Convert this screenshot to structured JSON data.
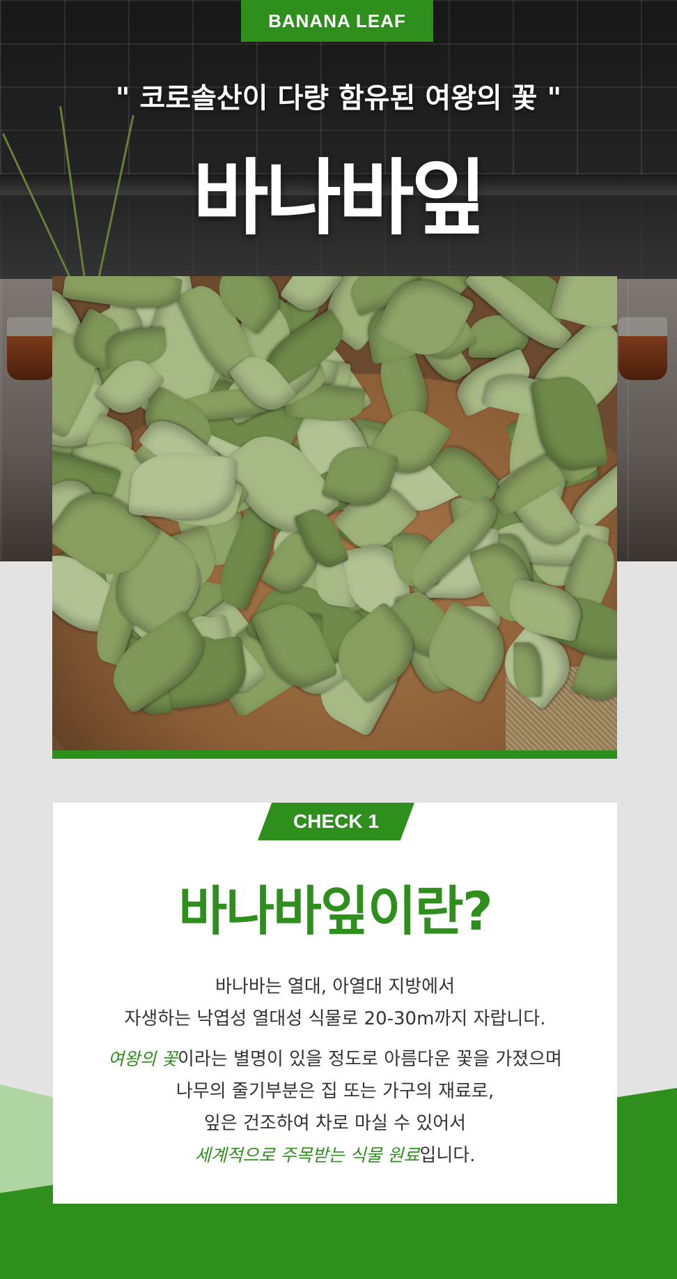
{
  "header": {
    "badge": "BANANA LEAF",
    "subtitle": "\" 코로솔산이 다량 함유된 여왕의 꽃 \"",
    "title": "바나바잎"
  },
  "check": {
    "tag": "CHECK 1",
    "title": "바나바잎이란?"
  },
  "description": {
    "line1": "바나바는 열대, 아열대 지방에서",
    "line2": "자생하는 낙엽성 열대성 식물로 20-30m까지 자랍니다.",
    "line3_highlight": "여왕의 꽃",
    "line3_rest": "이라는 별명이 있을 정도로 아름다운 꽃을 가졌으며",
    "line4": "나무의 줄기부분은 집 또는 가구의 재료로,",
    "line5": "잎은 건조하여 차로 마실 수 있어서",
    "line6_highlight": "세계적으로 주목받는 식물 원료",
    "line6_rest": "입니다."
  },
  "colors": {
    "brand_green": "#2f8f1d",
    "light_green": "#a9d49a",
    "background": "#e3e3e3"
  }
}
